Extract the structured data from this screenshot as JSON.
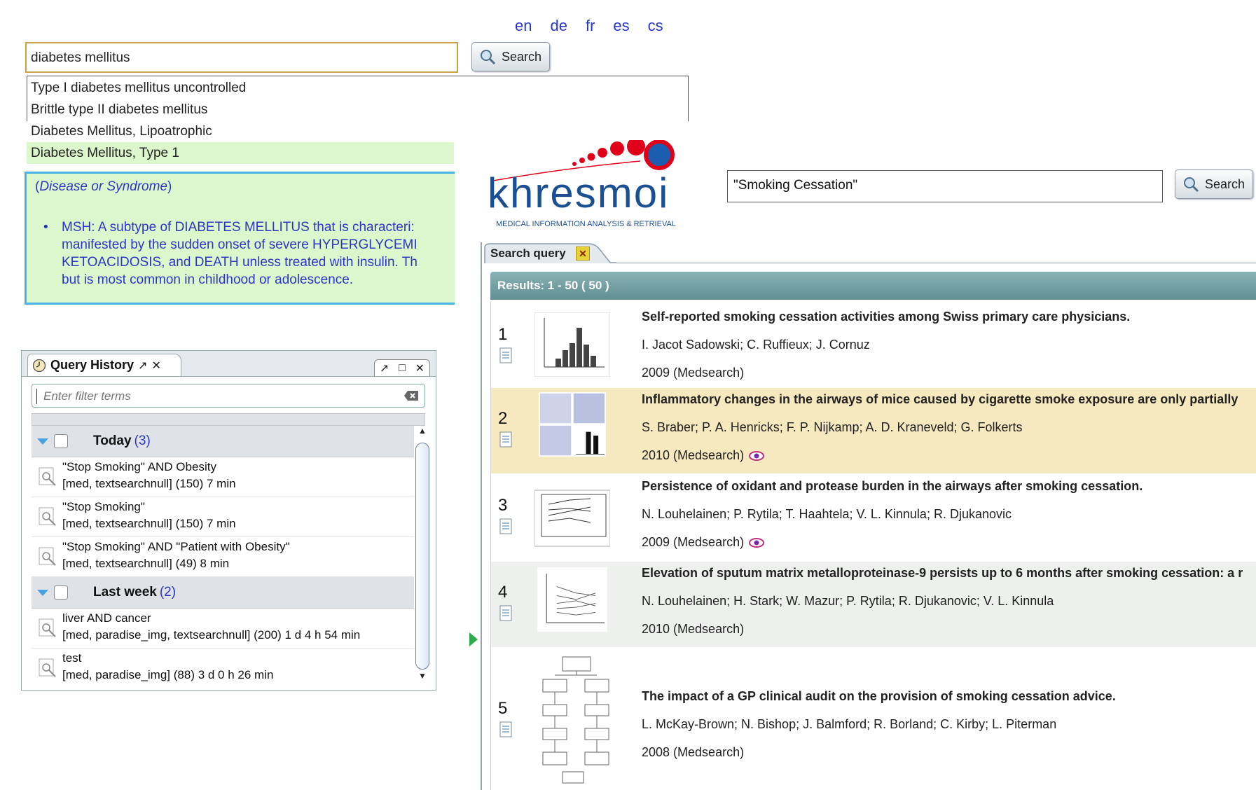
{
  "languages": [
    "en",
    "de",
    "fr",
    "es",
    "cs"
  ],
  "autocomplete": {
    "input_value": "diabetes mellitus",
    "search_label": "Search",
    "suggestions": [
      "Type I diabetes mellitus uncontrolled",
      "Brittle type II diabetes mellitus",
      "Diabetes Mellitus, Lipoatrophic",
      "Diabetes Mellitus, Type 1"
    ],
    "selected_index": 3,
    "detail": {
      "semantic_type": "Disease or Syndrome",
      "definition_lines": [
        "MSH: A subtype of DIABETES MELLITUS that is characteri:",
        "manifested by the sudden onset of severe HYPERGLYCEMI",
        "KETOACIDOSIS, and DEATH unless treated with insulin. Th",
        "but is most common in childhood or adolescence."
      ]
    }
  },
  "query_history": {
    "title": "Query History",
    "filter_placeholder": "Enter filter terms",
    "groups": [
      {
        "label": "Today",
        "count": "(3)",
        "items": [
          {
            "query": "\"Stop Smoking\" AND Obesity",
            "meta": "[med, textsearchnull] (150) 7 min"
          },
          {
            "query": "\"Stop Smoking\"",
            "meta": "[med, textsearchnull] (150) 7 min"
          },
          {
            "query": "\"Stop Smoking\" AND \"Patient with Obesity\"",
            "meta": "[med, textsearchnull] (49) 8 min"
          }
        ]
      },
      {
        "label": "Last week",
        "count": "(2)",
        "items": [
          {
            "query": "liver AND cancer",
            "meta": "[med, paradise_img, textsearchnull] (200) 1 d 4 h 54 min"
          },
          {
            "query": "test",
            "meta": "[med, paradise_img] (88) 3 d 0 h 26 min"
          }
        ]
      }
    ]
  },
  "khresmoi": {
    "logo_text": "khresmoi",
    "logo_tagline": "MEDICAL INFORMATION ANALYSIS & RETRIEVAL",
    "search_value": "\"Smoking Cessation\"",
    "search_label": "Search",
    "tab_label": "Search query",
    "results_header": "Results: 1 - 50 ( 50 )",
    "results": [
      {
        "num": "1",
        "title": "Self-reported smoking cessation activities among Swiss primary care physicians.",
        "authors": "I. Jacot Sadowski; C. Ruffieux; J. Cornuz",
        "year": "2009 (Medsearch)",
        "eye": false
      },
      {
        "num": "2",
        "title": "Inflammatory changes in the airways of mice caused by cigarette smoke exposure are only partially",
        "authors": "S. Braber; P. A. Henricks; F. P. Nijkamp; A. D. Kraneveld; G. Folkerts",
        "year": "2010 (Medsearch)",
        "eye": true
      },
      {
        "num": "3",
        "title": "Persistence of oxidant and protease burden in the airways after smoking cessation.",
        "authors": "N. Louhelainen; P. Rytila; T. Haahtela; V. L. Kinnula; R. Djukanovic",
        "year": "2009 (Medsearch)",
        "eye": true
      },
      {
        "num": "4",
        "title": "Elevation of sputum matrix metalloproteinase-9 persists up to 6 months after smoking cessation: a r",
        "authors": "N. Louhelainen; H. Stark; W. Mazur; P. Rytila; R. Djukanovic; V. L. Kinnula",
        "year": "2010 (Medsearch)",
        "eye": false
      },
      {
        "num": "5",
        "title": "The impact of a GP clinical audit on the provision of smoking cessation advice.",
        "authors": "L. McKay-Brown; N. Bishop; J. Balmford; R. Borland; C. Kirby; L. Piterman",
        "year": "2008 (Medsearch)",
        "eye": false
      }
    ]
  }
}
